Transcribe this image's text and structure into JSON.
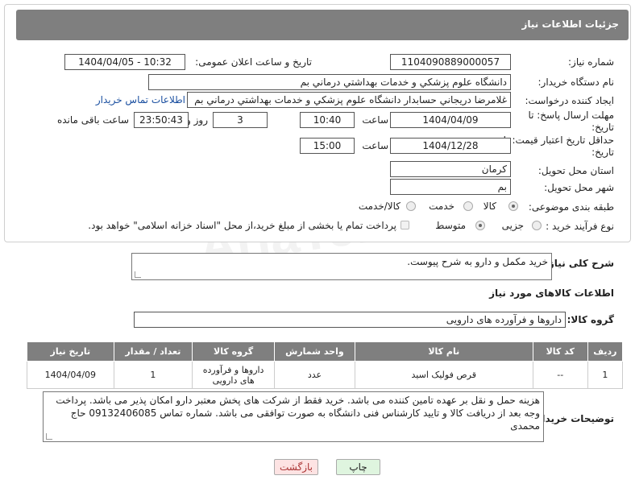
{
  "header": {
    "title": "جزئیات اطلاعات نیاز"
  },
  "fields": {
    "need_number_label": "شماره نیاز:",
    "need_number": "1104090889000057",
    "announce_label": "تاریخ و ساعت اعلان عمومی:",
    "announce_value": "1404/04/05 - 10:32",
    "buyer_org_label": "نام دستگاه خریدار:",
    "buyer_org": "دانشگاه علوم پزشکي و خدمات بهداشتي  درماني بم",
    "creator_label": "ایجاد کننده درخواست:",
    "creator": "غلامرضا دريجاني حسابدار دانشگاه علوم پزشکي و خدمات بهداشتي  درماني بم",
    "contact_link": "اطلاعات تماس خریدار",
    "deadline_label": "مهلت ارسال پاسخ: تا تاریخ:",
    "deadline_date": "1404/04/09",
    "time_word": "ساعت",
    "deadline_time": "10:40",
    "days_value": "3",
    "days_word": "روز و",
    "remaining_time": "23:50:43",
    "remaining_label": "ساعت باقی مانده",
    "price_validity_label": "حداقل تاریخ اعتبار قیمت: تا تاریخ:",
    "price_validity_date": "1404/12/28",
    "price_validity_time": "15:00",
    "province_label": "استان محل تحویل:",
    "province": "کرمان",
    "city_label": "شهر محل تحویل:",
    "city": "بم",
    "category_label": "طبقه بندی موضوعی:",
    "category_options": [
      "کالا",
      "خدمت",
      "کالا/خدمت"
    ],
    "process_label": "نوع فرآیند خرید :",
    "process_options": [
      "جزیی",
      "متوسط"
    ],
    "payment_note": "پرداخت تمام یا بخشی از مبلغ خرید،از محل \"اسناد خزانه اسلامی\" خواهد بود."
  },
  "description": {
    "label": "شرح کلی نیاز:",
    "value": "خرید مکمل و دارو به شرح پیوست."
  },
  "goods_section": {
    "title": "اطلاعات کالاهای مورد نیاز",
    "group_label": "گروه کالا:",
    "group_value": "داروها و فرآورده های دارویی"
  },
  "table": {
    "headers": [
      "ردیف",
      "کد کالا",
      "نام کالا",
      "واحد شمارش",
      "گروه کالا",
      "تعداد / مقدار",
      "تاریخ نیاز"
    ],
    "rows": [
      [
        "1",
        "--",
        "قرص فوليک اسيد",
        "عدد",
        "داروها و فرآورده های دارویی",
        "1",
        "1404/04/09"
      ]
    ]
  },
  "buyer_notes": {
    "label": "توضیحات خریدار:",
    "value": "هزینه حمل و نقل بر عهده تامین کننده می باشد. خرید فقط از شرکت های پخش معتبر دارو امکان پذیر می باشد. پرداخت وجه بعد از دریافت کالا و تایید کارشناس فنی دانشگاه به صورت توافقی می باشد. شماره تماس 09132406085 حاج محمدی"
  },
  "buttons": {
    "print": "چاپ",
    "back": "بازگشت"
  },
  "colors": {
    "header_bg": "#7f7f7f",
    "print_bg": "#dff5df",
    "back_bg": "#fde3e3"
  }
}
